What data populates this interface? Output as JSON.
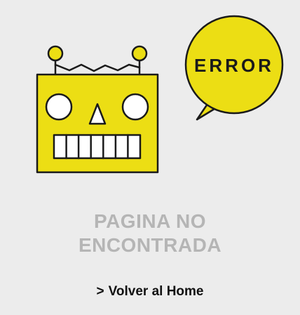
{
  "bubble": {
    "text": "ERROR"
  },
  "heading": {
    "line1": "PAGINA NO",
    "line2": "ENCONTRADA"
  },
  "link": {
    "arrow": ">",
    "label": "Volver al Home"
  },
  "colors": {
    "yellow": "#ecde14",
    "outline": "#1a1a1a",
    "background": "#ececec",
    "heading": "#b5b5b5"
  },
  "icons": {
    "robot": "robot-head-icon",
    "bubble": "speech-bubble-icon"
  }
}
